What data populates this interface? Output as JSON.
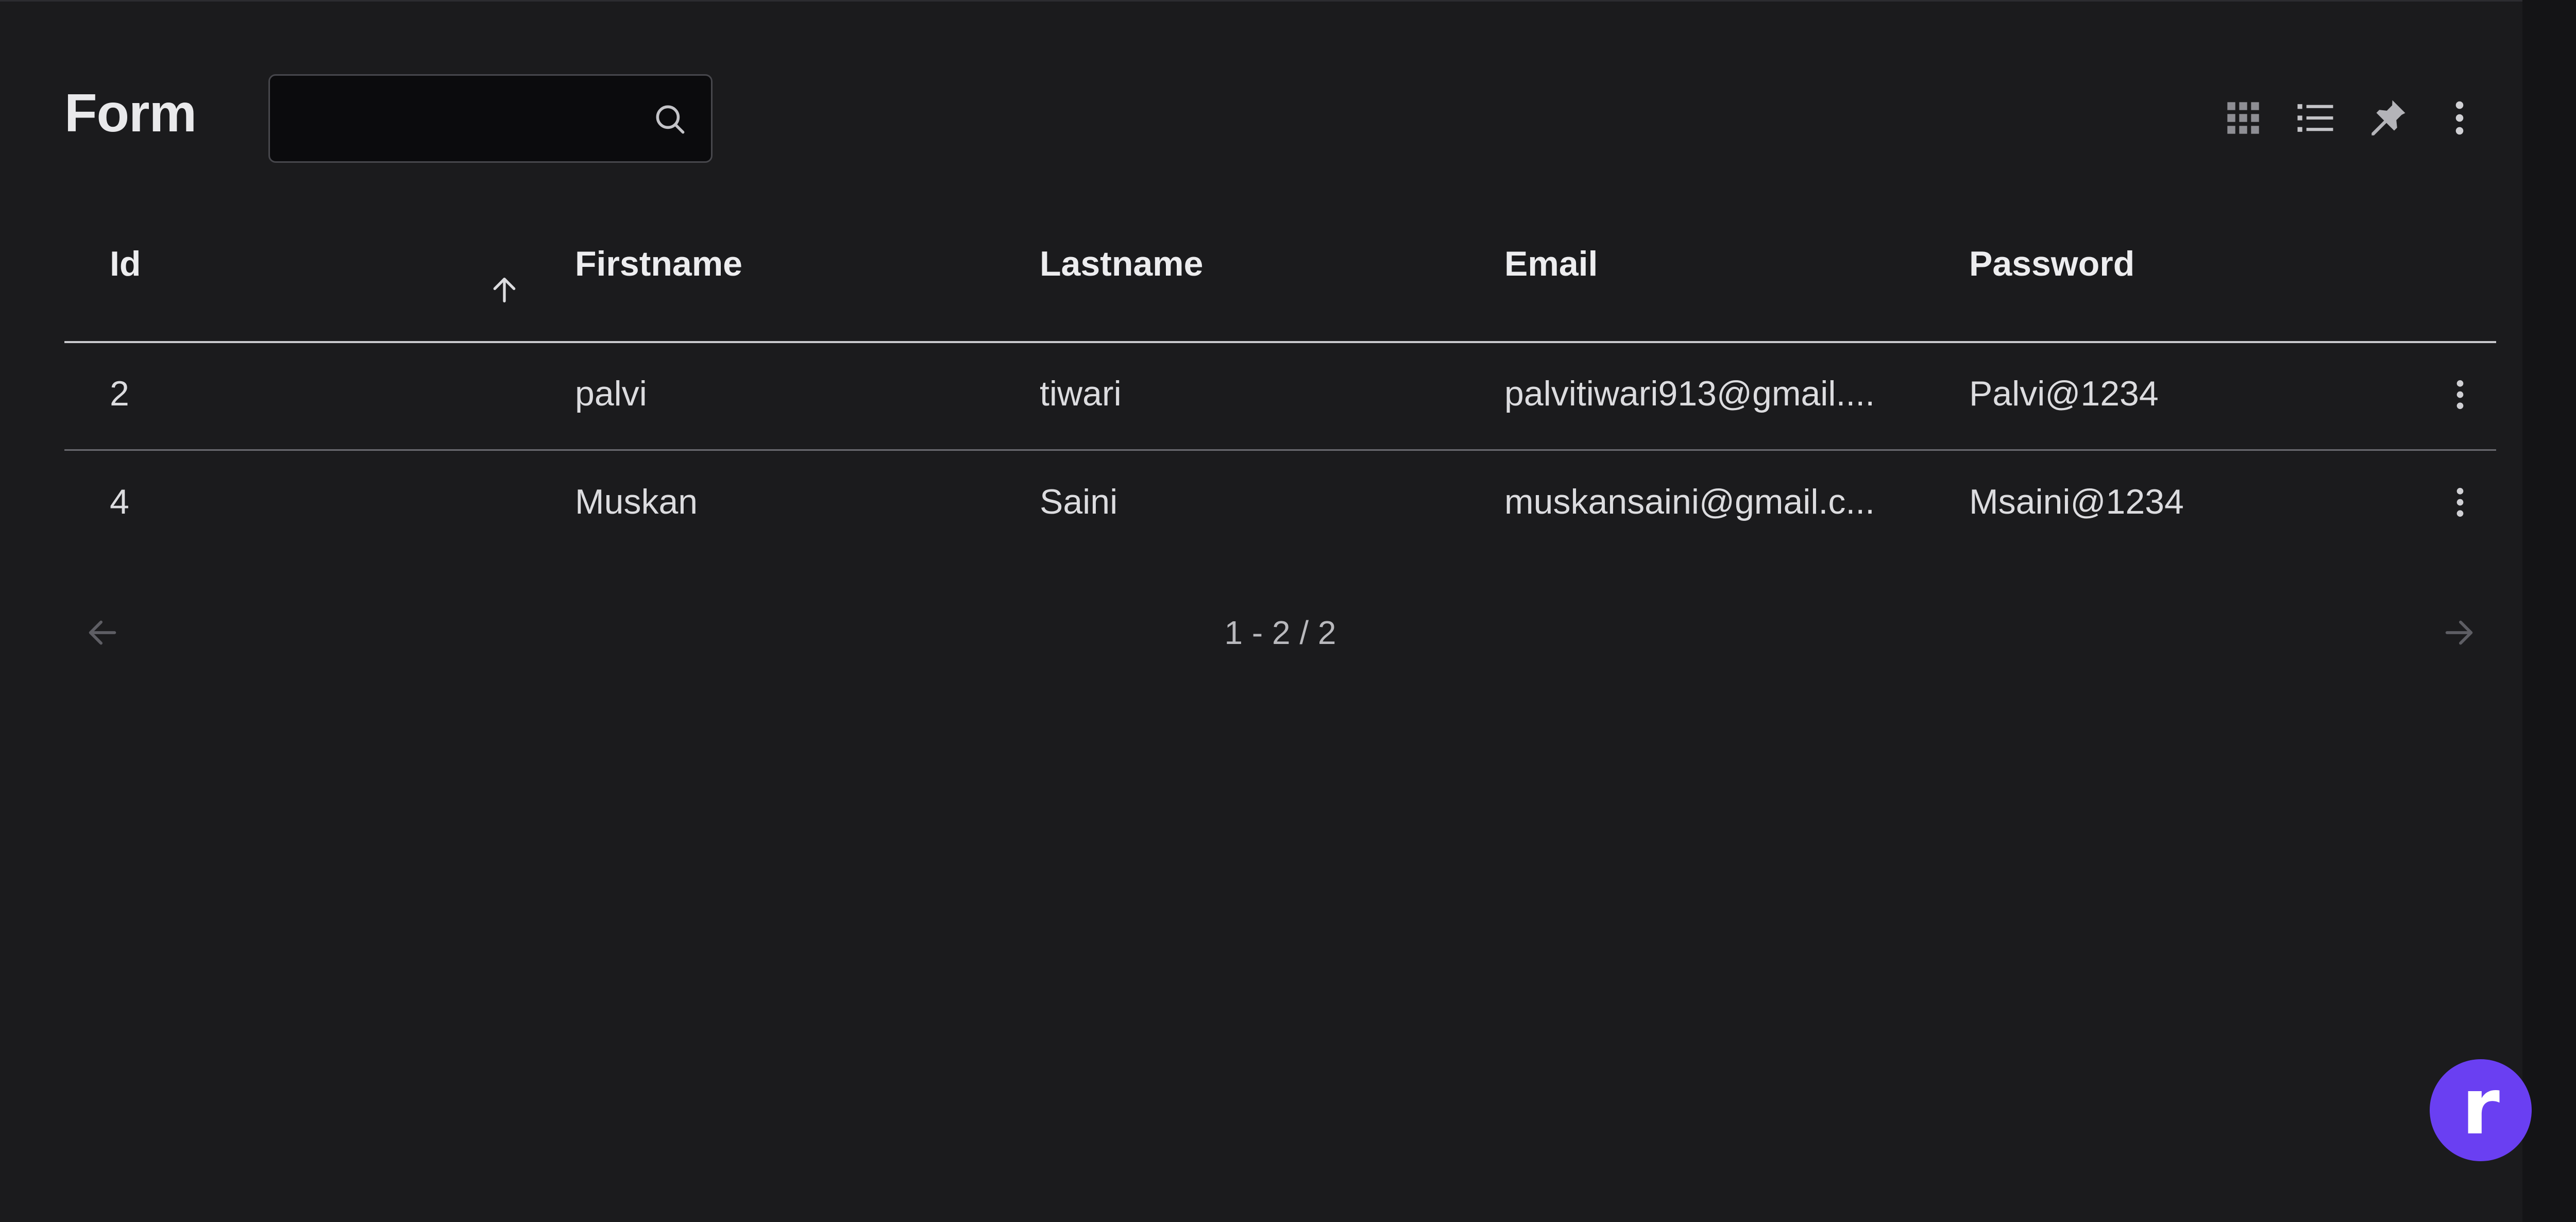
{
  "header": {
    "title": "Form",
    "search": {
      "value": "",
      "placeholder": ""
    },
    "icons": [
      "grid-view-icon",
      "list-view-icon",
      "pin-icon",
      "more-vertical-icon"
    ]
  },
  "table": {
    "columns": [
      "Id",
      "Firstname",
      "Lastname",
      "Email",
      "Password"
    ],
    "sort": {
      "column": "Id",
      "direction": "ascending"
    },
    "rows": [
      {
        "id": "2",
        "firstname": "palvi",
        "lastname": "tiwari",
        "email": "palvitiwari913@gmail....",
        "password": "Palvi@1234"
      },
      {
        "id": "4",
        "firstname": "Muskan",
        "lastname": "Saini",
        "email": "muskansaini@gmail.c...",
        "password": "Msaini@1234"
      }
    ]
  },
  "pagination": {
    "label": "1 - 2 / 2"
  },
  "brand": {
    "letter": "r",
    "color": "#6a3ff2"
  },
  "colors": {
    "background": "#1b1b1d",
    "text": "#e6e6e8"
  }
}
